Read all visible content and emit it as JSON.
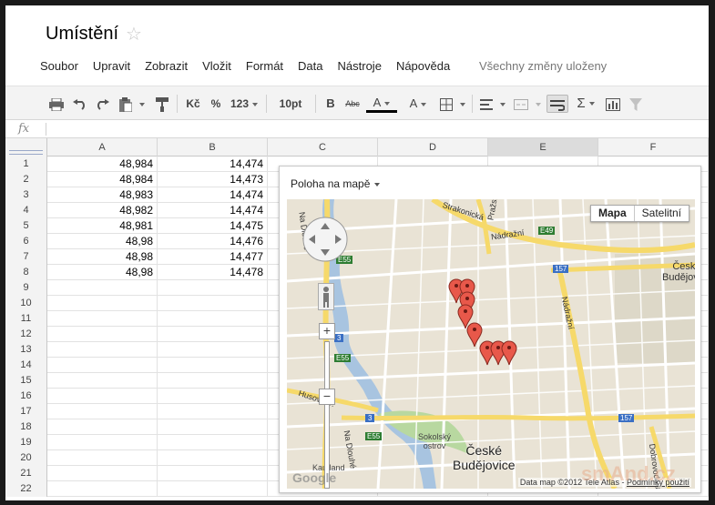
{
  "header": {
    "title": "Umístění",
    "save_status": "Všechny změny uloženy"
  },
  "menu": [
    "Soubor",
    "Upravit",
    "Zobrazit",
    "Vložit",
    "Formát",
    "Data",
    "Nástroje",
    "Nápověda"
  ],
  "toolbar": {
    "currency": "Kč",
    "percent": "%",
    "number_format": "123",
    "font_size": "10pt",
    "bold": "B",
    "strike": "Abc",
    "text_color": "A",
    "fill_color": "A",
    "function": "Σ"
  },
  "formula": {
    "label": "fx"
  },
  "columns": [
    "A",
    "B",
    "C",
    "D",
    "E",
    "F"
  ],
  "selected_column": "E",
  "rows": [
    {
      "n": "1",
      "a": "48,984",
      "b": "14,474"
    },
    {
      "n": "2",
      "a": "48,984",
      "b": "14,473"
    },
    {
      "n": "3",
      "a": "48,983",
      "b": "14,474"
    },
    {
      "n": "4",
      "a": "48,982",
      "b": "14,474"
    },
    {
      "n": "5",
      "a": "48,981",
      "b": "14,475"
    },
    {
      "n": "6",
      "a": "48,98",
      "b": "14,476"
    },
    {
      "n": "7",
      "a": "48,98",
      "b": "14,477"
    },
    {
      "n": "8",
      "a": "48,98",
      "b": "14,478"
    },
    {
      "n": "9",
      "a": "",
      "b": ""
    },
    {
      "n": "10",
      "a": "",
      "b": ""
    },
    {
      "n": "11",
      "a": "",
      "b": ""
    },
    {
      "n": "12",
      "a": "",
      "b": ""
    },
    {
      "n": "13",
      "a": "",
      "b": ""
    },
    {
      "n": "14",
      "a": "",
      "b": ""
    },
    {
      "n": "15",
      "a": "",
      "b": ""
    },
    {
      "n": "16",
      "a": "",
      "b": ""
    },
    {
      "n": "17",
      "a": "",
      "b": ""
    },
    {
      "n": "18",
      "a": "",
      "b": ""
    },
    {
      "n": "19",
      "a": "",
      "b": ""
    },
    {
      "n": "20",
      "a": "",
      "b": ""
    },
    {
      "n": "21",
      "a": "",
      "b": ""
    },
    {
      "n": "22",
      "a": "",
      "b": ""
    }
  ],
  "map": {
    "title": "Poloha na mapě",
    "type_map": "Mapa",
    "type_satellite": "Satelitní",
    "city_line1": "České",
    "city_line2": "Budějovice",
    "north_label1": "České",
    "north_label2": "Budějovice",
    "streets": [
      "Strakonická",
      "Nádražní",
      "Nádražní",
      "Husova tř.",
      "Na Dlouhé",
      "Na Dlouhé",
      "Dobrovodská",
      "Pražská"
    ],
    "road_badges": [
      "E55",
      "E55",
      "E55",
      "3",
      "3",
      "157",
      "157",
      "E49"
    ],
    "places": [
      "Sokolský ostrov",
      "Kaufland"
    ],
    "logo": "Google",
    "attribution": "Data map ©2012 Tele Atlas -",
    "terms": "Podmínky použití"
  },
  "watermark": "smAnd.cz"
}
